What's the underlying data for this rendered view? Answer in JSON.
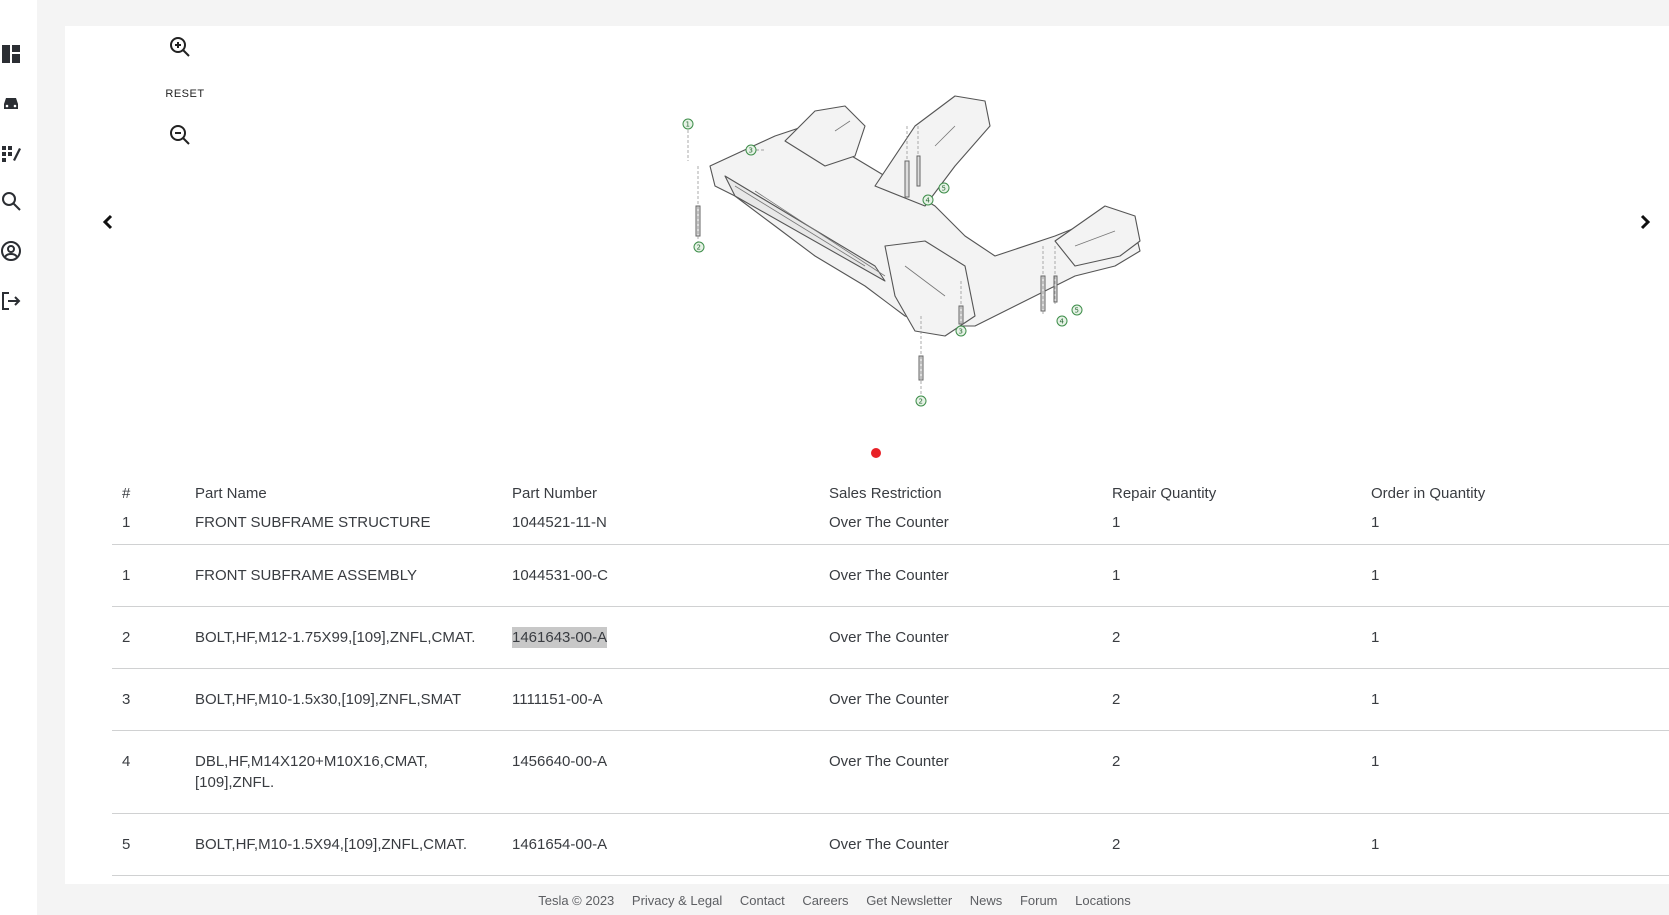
{
  "sidebar": {
    "icons": [
      "dashboard-icon",
      "vehicle-icon",
      "catalog-icon",
      "search-icon",
      "account-icon",
      "logout-icon"
    ]
  },
  "viewer": {
    "reset_label": "RESET",
    "callouts": [
      "1",
      "2",
      "3",
      "4",
      "5",
      "2",
      "3",
      "4",
      "5",
      "2"
    ]
  },
  "table": {
    "headers": [
      "#",
      "Part Name",
      "Part Number",
      "Sales Restriction",
      "Repair Quantity",
      "Order in Quantity"
    ],
    "rows": [
      {
        "num": "1",
        "name": "FRONT SUBFRAME STRUCTURE",
        "number": "1044521-11-N",
        "restriction": "Over The Counter",
        "repair_qty": "1",
        "order_qty": "1"
      },
      {
        "num": "1",
        "name": "FRONT SUBFRAME ASSEMBLY",
        "number": "1044531-00-C",
        "restriction": "Over The Counter",
        "repair_qty": "1",
        "order_qty": "1"
      },
      {
        "num": "2",
        "name": "BOLT,HF,M12-1.75X99,[109],ZNFL,CMAT.",
        "number": "1461643-00-A",
        "restriction": "Over The Counter",
        "repair_qty": "2",
        "order_qty": "1"
      },
      {
        "num": "3",
        "name": "BOLT,HF,M10-1.5x30,[109],ZNFL,SMAT",
        "number": "1111151-00-A",
        "restriction": "Over The Counter",
        "repair_qty": "2",
        "order_qty": "1"
      },
      {
        "num": "4",
        "name": "DBL,HF,M14X120+M10X16,CMAT,",
        "name2": "[109],ZNFL.",
        "number": "1456640-00-A",
        "restriction": "Over The Counter",
        "repair_qty": "2",
        "order_qty": "1"
      },
      {
        "num": "5",
        "name": "BOLT,HF,M10-1.5X94,[109],ZNFL,CMAT.",
        "number": "1461654-00-A",
        "restriction": "Over The Counter",
        "repair_qty": "2",
        "order_qty": "1"
      }
    ]
  },
  "footer": {
    "links": [
      "Tesla © 2023",
      "Privacy & Legal",
      "Contact",
      "Careers",
      "Get Newsletter",
      "News",
      "Forum",
      "Locations"
    ]
  },
  "colors": {
    "indicator": "#e82127",
    "highlight": "#c8c8c8",
    "callout_green": "#3e8e4a"
  }
}
